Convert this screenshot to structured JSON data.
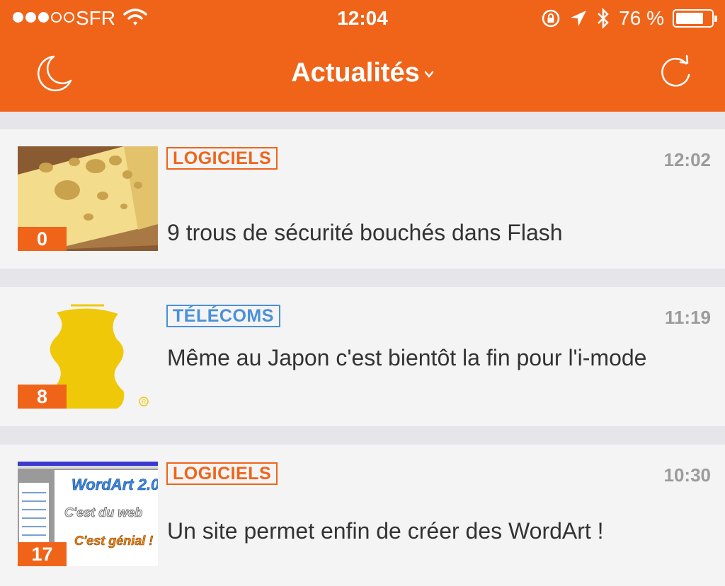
{
  "status_bar": {
    "carrier": "SFR",
    "time": "12:04",
    "battery_text": "76 %",
    "battery_level": 0.76,
    "signal_bars_filled": 3,
    "signal_bars_total": 5
  },
  "header": {
    "title": "Actualités",
    "left_icon": "moon-icon",
    "right_icon": "refresh-icon"
  },
  "colors": {
    "brand": "#f0641a",
    "tag_blue": "#4a90d9",
    "text": "#333333",
    "muted": "#9b9b9b"
  },
  "articles": [
    {
      "category": "LOGICIELS",
      "category_color": "orange",
      "time": "12:02",
      "title": "9 trous de sécurité bouchés dans Flash",
      "comments": "0",
      "thumbnail": "cheese-image"
    },
    {
      "category": "TÉLÉCOMS",
      "category_color": "blue",
      "time": "11:19",
      "title": "Même au Japon c'est bientôt la fin pour l'i-mode",
      "comments": "8",
      "thumbnail": "imode-logo-image"
    },
    {
      "category": "LOGICIELS",
      "category_color": "orange",
      "time": "10:30",
      "title": "Un site permet enfin de créer des WordArt !",
      "comments": "17",
      "thumbnail": "wordart-screenshot-image",
      "thumbnail_text": [
        "WordArt 2.0",
        "C'est du web",
        "C'est génial !"
      ]
    }
  ]
}
